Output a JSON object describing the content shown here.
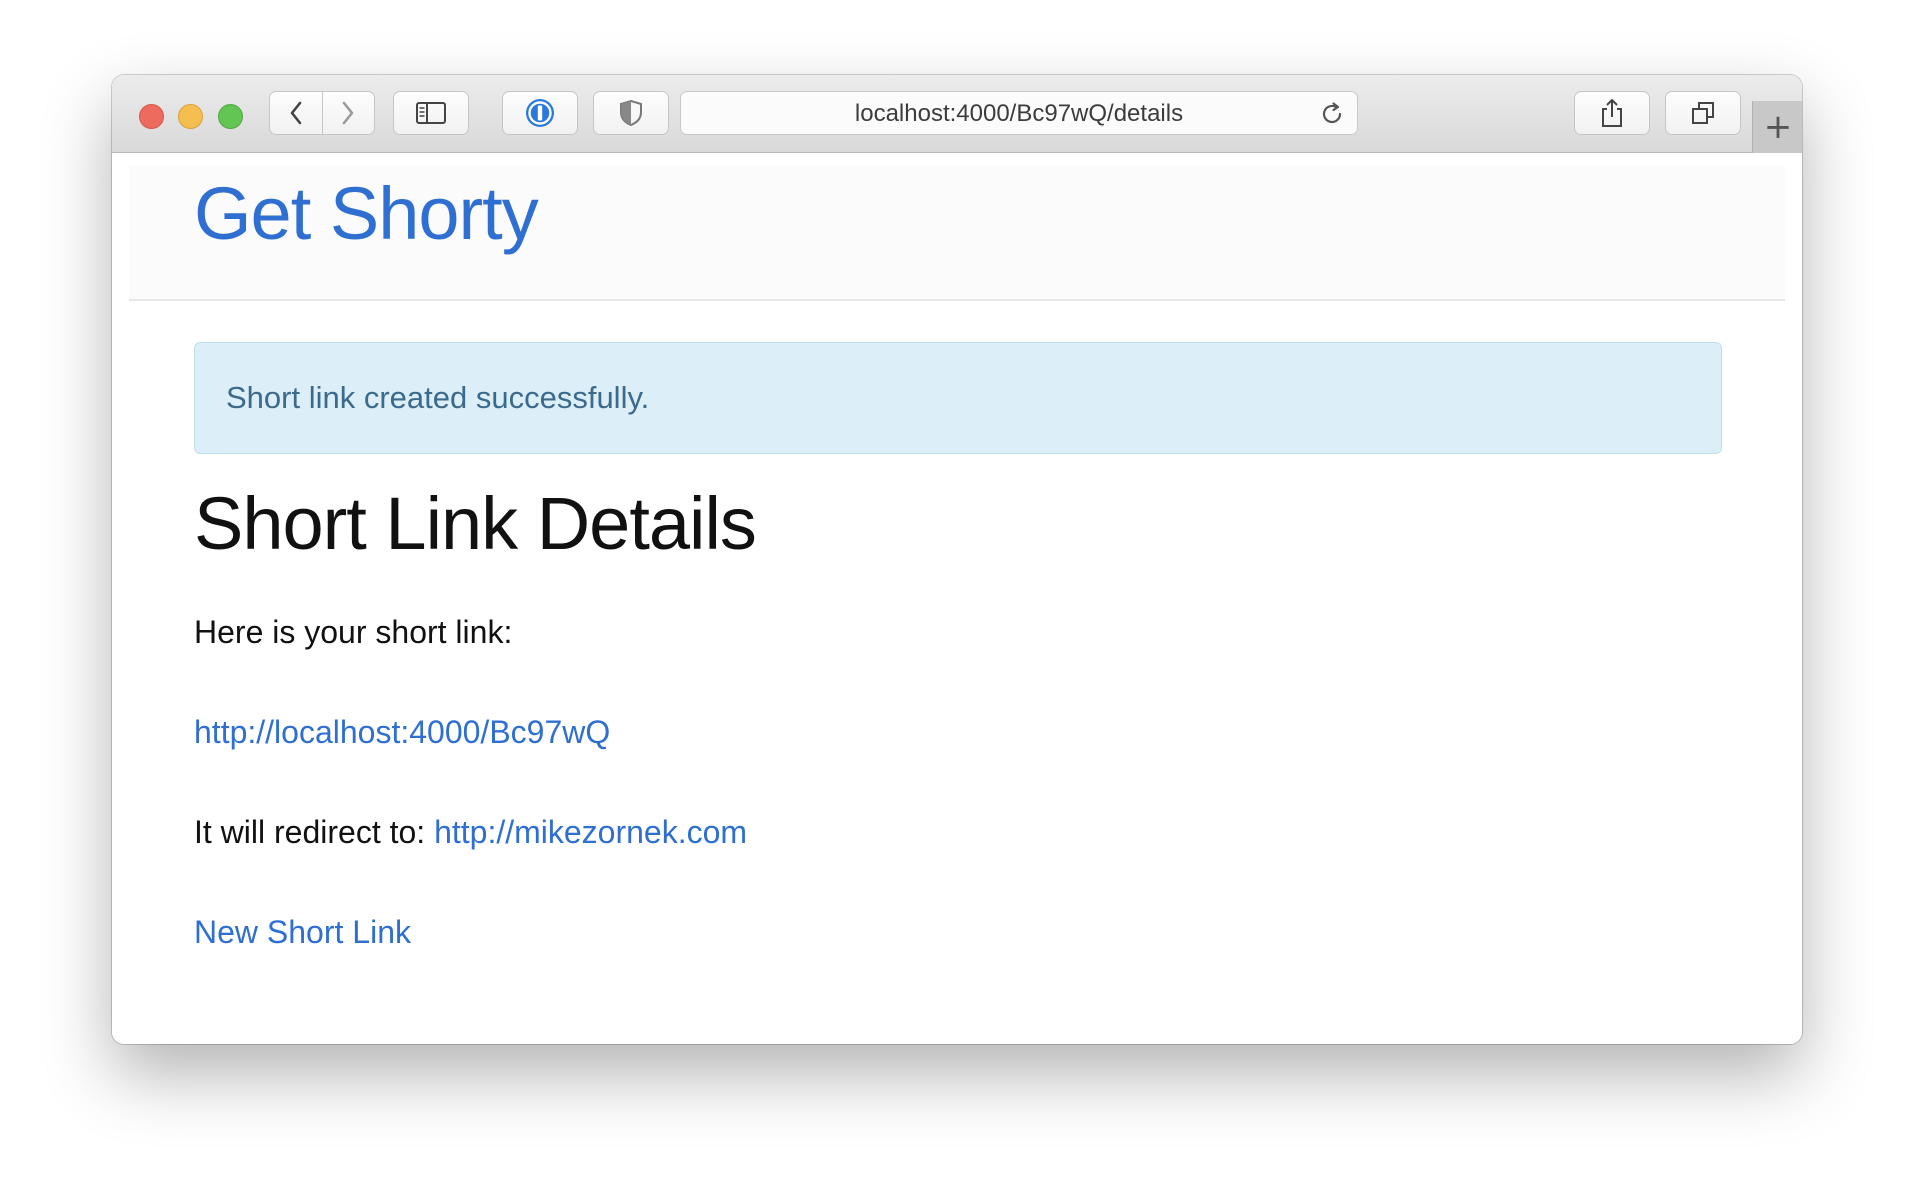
{
  "browser": {
    "address_url": "localhost:4000/Bc97wQ/details",
    "new_tab_symbol": "+",
    "icons": [
      "back-icon",
      "forward-icon",
      "sidebar-icon",
      "password-manager-icon",
      "shield-icon",
      "reload-icon",
      "share-icon",
      "tabs-overview-icon"
    ]
  },
  "page": {
    "brand": "Get Shorty",
    "alert": "Short link created successfully.",
    "heading": "Short Link Details",
    "intro": "Here is your short link:",
    "short_link": "http://localhost:4000/Bc97wQ",
    "redirect_label": "It will redirect to:",
    "redirect_url": "http://mikezornek.com",
    "new_link": "New Short Link"
  },
  "colors": {
    "link": "#2f6fd1",
    "alert_bg": "#dceef7",
    "alert_text": "#3b6a8c"
  }
}
